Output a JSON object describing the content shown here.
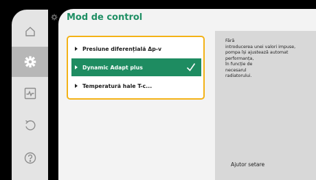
{
  "nav": {
    "items": [
      {
        "id": "home",
        "icon": "home-icon",
        "active": false
      },
      {
        "id": "settings",
        "icon": "gear-icon",
        "active": true
      },
      {
        "id": "diagnostics",
        "icon": "heartbeat-monitor-icon",
        "active": false
      },
      {
        "id": "restore",
        "icon": "undo-icon",
        "active": false
      },
      {
        "id": "help",
        "icon": "question-icon",
        "active": false
      }
    ]
  },
  "header": {
    "breadcrumb_icon": "gear-icon",
    "title": "Mod de control"
  },
  "options": [
    {
      "label": "Presiune diferențială Δp-v",
      "selected": false
    },
    {
      "label": "Dynamic Adapt plus",
      "selected": true
    },
    {
      "label": "Temperatură hale T-c...",
      "selected": false
    }
  ],
  "info": {
    "lines": [
      "Fără",
      "introducerea unei valori impuse,",
      "pompa își ajustează automat",
      "performanța,",
      "în funcție de",
      "necesarul",
      "radiatorului."
    ],
    "help_label": "Ajutor setare"
  },
  "colors": {
    "accent": "#1e8c61",
    "title": "#1f8f64",
    "focus_frame": "#f3b114",
    "rail": "#e4e4e4",
    "rail_active": "#b7b7b7",
    "info_panel": "#d8d8d8"
  }
}
